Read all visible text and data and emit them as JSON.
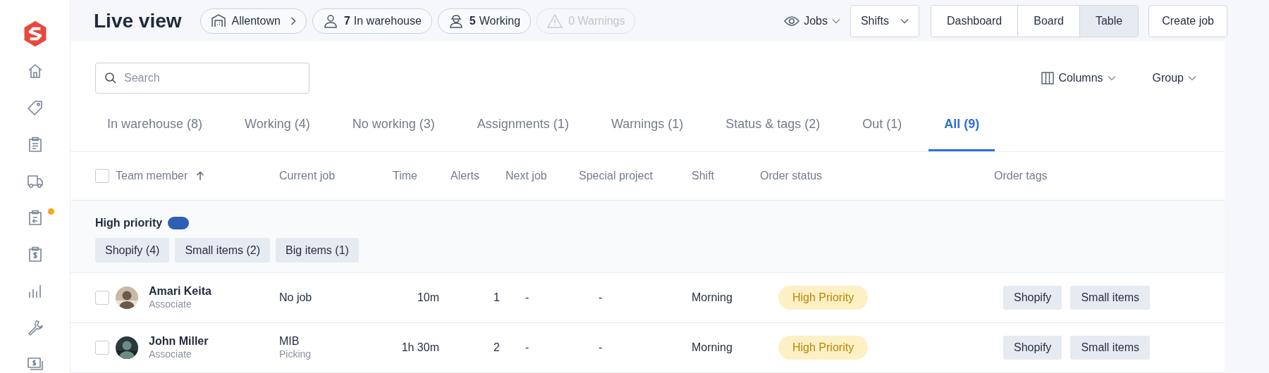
{
  "sidebar": {
    "items": [
      {
        "kind": "home",
        "notification": false
      },
      {
        "kind": "tag",
        "notification": false
      },
      {
        "kind": "clipboard",
        "notification": false
      },
      {
        "kind": "truck",
        "notification": false
      },
      {
        "kind": "return",
        "notification": true
      },
      {
        "kind": "invoice",
        "notification": false
      },
      {
        "kind": "chart",
        "notification": false
      },
      {
        "kind": "wrench",
        "notification": false
      },
      {
        "kind": "billing",
        "notification": false
      }
    ]
  },
  "header": {
    "title": "Live view",
    "chips": [
      {
        "kind": "location",
        "label": "Allentown",
        "disabled": false
      },
      {
        "kind": "people",
        "count": "7",
        "label": "In warehouse",
        "disabled": false
      },
      {
        "kind": "worker",
        "count": "5",
        "label": "Working",
        "disabled": false
      },
      {
        "kind": "warning",
        "label": "0 Warnings",
        "disabled": true
      }
    ],
    "view_menu": "Jobs",
    "shifts": "Shifts",
    "views": [
      {
        "label": "Dashboard",
        "selected": false
      },
      {
        "label": "Board",
        "selected": false
      },
      {
        "label": "Table",
        "selected": true
      }
    ],
    "create_button": "Create job"
  },
  "toolbar": {
    "search": {
      "placeholder": "Search"
    },
    "columns": "Columns",
    "group": "Group"
  },
  "tabs": [
    {
      "label": "In warehouse (8)",
      "selected": false
    },
    {
      "label": "Working (4)",
      "selected": false
    },
    {
      "label": "No working (3)",
      "selected": false
    },
    {
      "label": "Assignments (1)",
      "selected": false
    },
    {
      "label": "Warnings (1)",
      "selected": false
    },
    {
      "label": "Status & tags (2)",
      "selected": false
    },
    {
      "label": "Out (1)",
      "selected": false
    },
    {
      "label": "All (9)",
      "selected": true
    }
  ],
  "table": {
    "select_all": {
      "checked": false
    },
    "columns": [
      {
        "label": "Team member",
        "sorted": true
      },
      {
        "label": "Current job",
        "sorted": false
      },
      {
        "label": "Time",
        "sorted": false
      },
      {
        "label": "Alerts",
        "sorted": false
      },
      {
        "label": "Next job",
        "sorted": false
      },
      {
        "label": "Special project",
        "sorted": false
      },
      {
        "label": "Shift",
        "sorted": false
      },
      {
        "label": "Order status",
        "sorted": false
      },
      {
        "label": "Order tags",
        "sorted": false
      }
    ],
    "group": {
      "title": "High priority",
      "on": true,
      "tags": [
        "Shopify (4)",
        "Small items (2)",
        "Big items (1)"
      ]
    },
    "rows": [
      {
        "checked": false,
        "name": "Amari Keita",
        "role": "Associate",
        "current_job": "No job",
        "time": "10m",
        "alerts": "1",
        "next_job": "-",
        "special_project": "-",
        "shift": "Morning",
        "order_status": "High Priority",
        "order_tags": [
          "Shopify",
          "Small items"
        ]
      },
      {
        "checked": false,
        "name": "John Miller",
        "role": "Associate",
        "current_job": "MIB",
        "job_detail": "Picking",
        "time": "1h 30m",
        "alerts": "2",
        "next_job": "-",
        "special_project": "-",
        "shift": "Morning",
        "order_status": "High Priority",
        "order_tags": [
          "Shopify",
          "Small items"
        ]
      }
    ]
  }
}
